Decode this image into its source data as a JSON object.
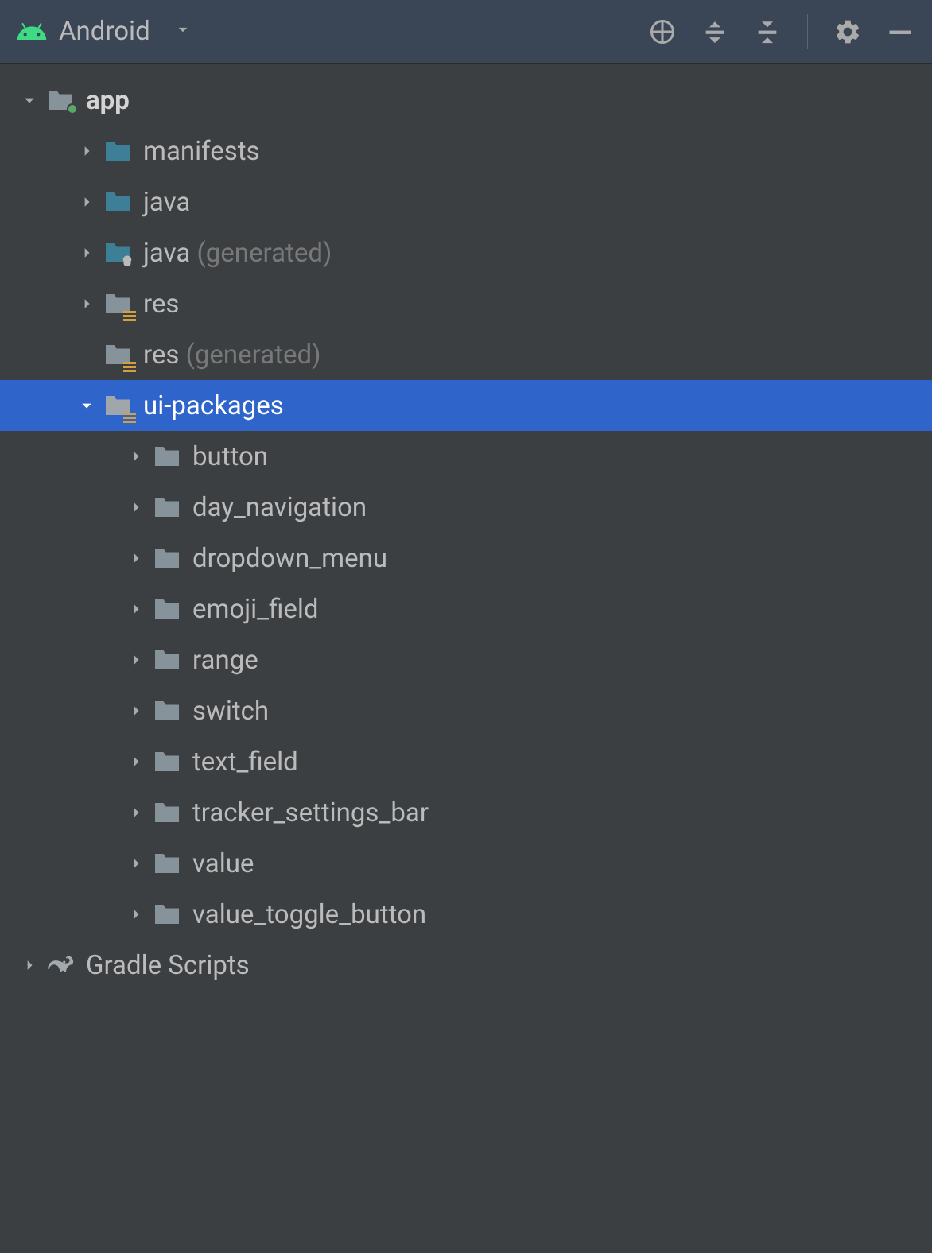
{
  "toolbar": {
    "view_selector": "Android"
  },
  "tree": {
    "root": {
      "label": "app",
      "children": [
        {
          "label": "manifests",
          "suffix": ""
        },
        {
          "label": "java",
          "suffix": ""
        },
        {
          "label": "java",
          "suffix": " (generated)"
        },
        {
          "label": "res",
          "suffix": ""
        },
        {
          "label": "res",
          "suffix": " (generated)"
        },
        {
          "label": "ui-packages",
          "suffix": "",
          "children": [
            {
              "label": "button"
            },
            {
              "label": "day_navigation"
            },
            {
              "label": "dropdown_menu"
            },
            {
              "label": "emoji_field"
            },
            {
              "label": "range"
            },
            {
              "label": "switch"
            },
            {
              "label": "text_field"
            },
            {
              "label": "tracker_settings_bar"
            },
            {
              "label": "value"
            },
            {
              "label": "value_toggle_button"
            }
          ]
        }
      ]
    },
    "gradle": {
      "label": "Gradle Scripts"
    }
  }
}
